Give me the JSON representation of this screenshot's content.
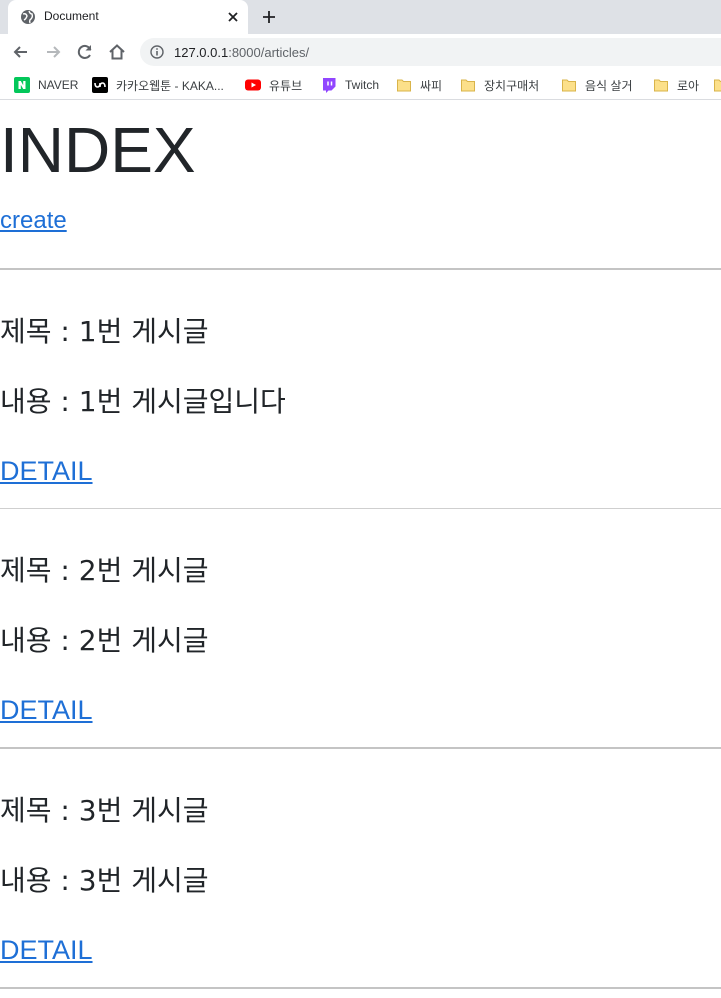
{
  "browser": {
    "tab": {
      "title": "Document",
      "favicon": "globe-icon",
      "close": "close-icon"
    },
    "new_tab": "plus-icon",
    "url": {
      "host": "127.0.0.1",
      "rest": ":8000/articles/"
    },
    "bookmarks": [
      {
        "label": "NAVER",
        "icon": "naver-icon",
        "color": "#03c75a"
      },
      {
        "label": "카카오웹툰 - KAKA...",
        "icon": "kakao-webtoon-icon",
        "color": "#000000"
      },
      {
        "label": "유튜브",
        "icon": "youtube-icon",
        "color": "#ff0000"
      },
      {
        "label": "Twitch",
        "icon": "twitch-icon",
        "color": "#9146ff"
      },
      {
        "label": "싸피",
        "icon": "folder-icon",
        "color": "#fce08a"
      },
      {
        "label": "장치구매처",
        "icon": "folder-icon",
        "color": "#fce08a"
      },
      {
        "label": "음식 살거",
        "icon": "folder-icon",
        "color": "#fce08a"
      },
      {
        "label": "로아",
        "icon": "folder-icon",
        "color": "#fce08a"
      }
    ]
  },
  "page": {
    "heading": "INDEX",
    "create_link": "create",
    "articles": [
      {
        "title_line": "제목 : 1번 게시글",
        "content_line": "내용 : 1번 게시글입니다",
        "detail": "DETAIL"
      },
      {
        "title_line": "제목 : 2번 게시글",
        "content_line": "내용 : 2번 게시글",
        "detail": "DETAIL"
      },
      {
        "title_line": "제목 : 3번 게시글",
        "content_line": "내용 : 3번 게시글",
        "detail": "DETAIL"
      }
    ],
    "link_color": "#1e6fd6"
  }
}
